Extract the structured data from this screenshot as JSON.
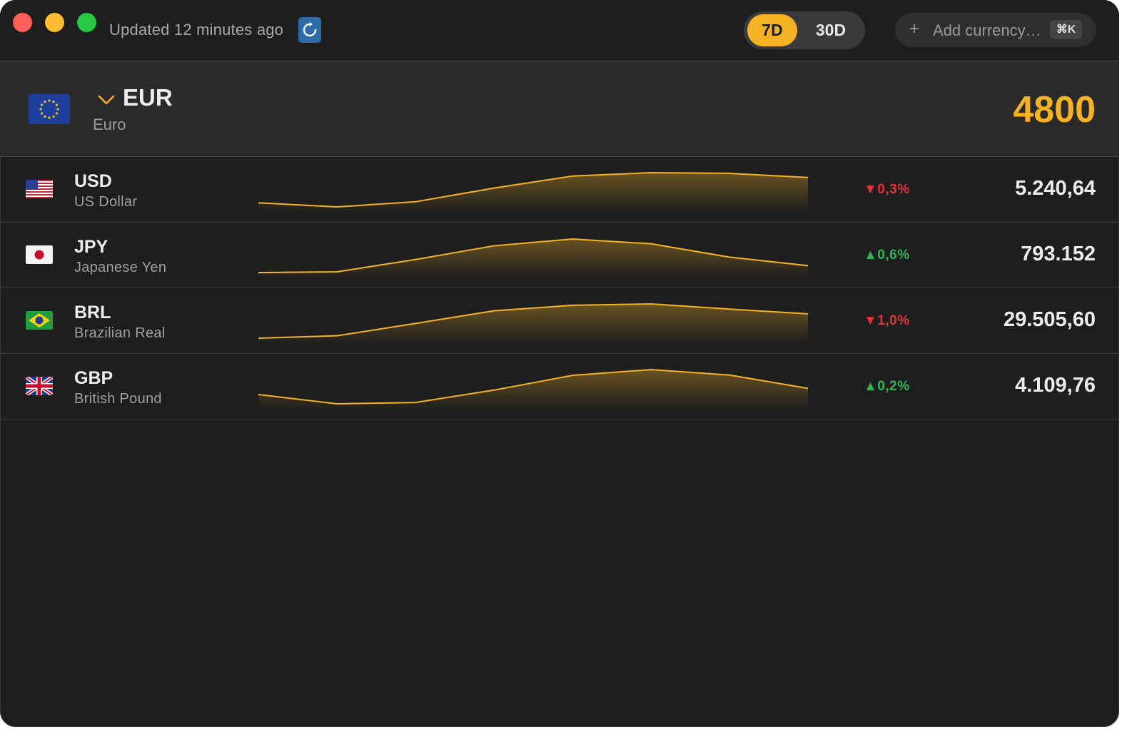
{
  "header": {
    "updated_text": "Updated 12 minutes ago",
    "refresh_icon": "refresh-icon",
    "periods": [
      {
        "label": "7D",
        "selected": true
      },
      {
        "label": "30D",
        "selected": false
      }
    ],
    "add_currency": {
      "label": "Add currency…",
      "shortcut": "⌘K"
    }
  },
  "colors": {
    "accent": "#f5b324",
    "up": "#30b455",
    "down": "#e0343a",
    "window_bg": "#1e1e1e",
    "base_bg": "#2a2a2a"
  },
  "base_currency": {
    "code": "EUR",
    "name": "Euro",
    "amount": "4800",
    "flag_icon": "eu-flag-icon"
  },
  "currencies": [
    {
      "code": "USD",
      "name": "US Dollar",
      "change": "▼0,3%",
      "direction": "down",
      "value": "5.240,64",
      "flag_icon": "us-flag-icon",
      "trend": [
        0.12,
        0.0,
        0.15,
        0.55,
        0.9,
        1.0,
        0.98,
        0.86
      ]
    },
    {
      "code": "JPY",
      "name": "Japanese Yen",
      "change": "▲0,6%",
      "direction": "up",
      "value": "793.152",
      "flag_icon": "jp-flag-icon",
      "trend": [
        0.0,
        0.02,
        0.38,
        0.78,
        0.98,
        0.84,
        0.45,
        0.2
      ]
    },
    {
      "code": "BRL",
      "name": "Brazilian Real",
      "change": "▼1,0%",
      "direction": "down",
      "value": "29.505,60",
      "flag_icon": "br-flag-icon",
      "trend": [
        0.0,
        0.07,
        0.43,
        0.8,
        0.96,
        1.0,
        0.85,
        0.71
      ]
    },
    {
      "code": "GBP",
      "name": "British Pound",
      "change": "▲0,2%",
      "direction": "up",
      "value": "4.109,76",
      "flag_icon": "gb-flag-icon",
      "trend": [
        0.27,
        0.0,
        0.04,
        0.4,
        0.83,
        1.0,
        0.84,
        0.45
      ]
    }
  ]
}
